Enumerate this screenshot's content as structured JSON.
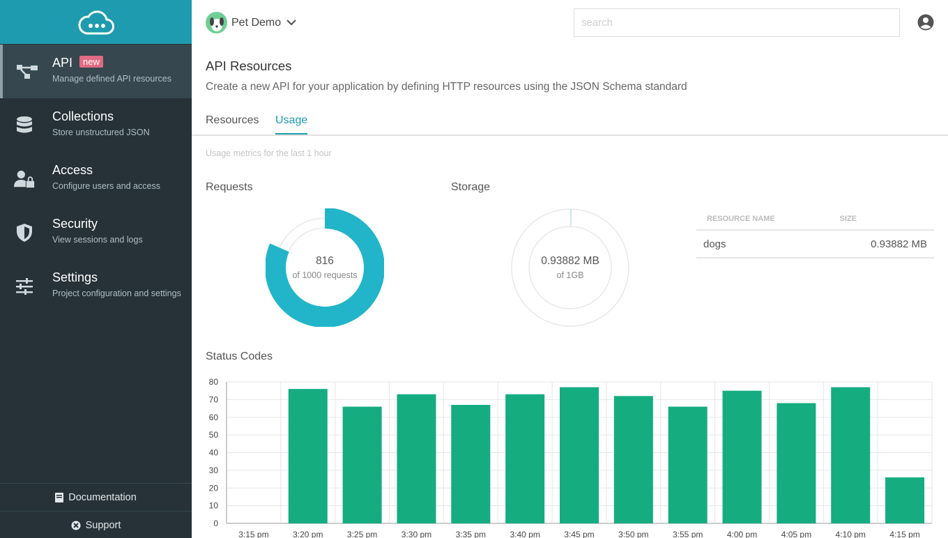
{
  "sidebar": {
    "items": [
      {
        "title": "API",
        "subtitle": "Manage defined API resources",
        "badge": "new",
        "icon": "api-icon"
      },
      {
        "title": "Collections",
        "subtitle": "Store unstructured JSON",
        "icon": "database-icon"
      },
      {
        "title": "Access",
        "subtitle": "Configure users and access",
        "icon": "user-lock-icon"
      },
      {
        "title": "Security",
        "subtitle": "View sessions and logs",
        "icon": "shield-icon"
      },
      {
        "title": "Settings",
        "subtitle": "Project configuration and settings",
        "icon": "sliders-icon"
      }
    ],
    "footer": {
      "documentation": "Documentation",
      "support": "Support"
    }
  },
  "header": {
    "project_name": "Pet Demo",
    "search_placeholder": "search"
  },
  "main": {
    "title": "API Resources",
    "description": "Create a new API for your application by defining HTTP resources using the JSON Schema standard",
    "tabs": [
      {
        "label": "Resources"
      },
      {
        "label": "Usage"
      }
    ],
    "active_tab": "Usage",
    "metrics_note": "Usage metrics for the last 1 hour",
    "requests": {
      "title": "Requests",
      "value": "816",
      "sub": "of 1000 requests",
      "used": 816,
      "total": 1000
    },
    "storage": {
      "title": "Storage",
      "value": "0.93882 MB",
      "sub": "of 1GB",
      "fraction": 0.00092
    },
    "resource_table": {
      "headers": [
        "RESOURCE NAME",
        "SIZE"
      ],
      "rows": [
        {
          "name": "dogs",
          "size": "0.93882 MB"
        }
      ]
    }
  },
  "colors": {
    "accent": "#1e9bae",
    "donut": "#22b5c9",
    "bars": "#15ac80",
    "sidebar": "#263238"
  },
  "chart_data": {
    "type": "bar",
    "title": "Status Codes",
    "categories": [
      "3:15 pm",
      "3:20 pm",
      "3:25 pm",
      "3:30 pm",
      "3:35 pm",
      "3:40 pm",
      "3:45 pm",
      "3:50 pm",
      "3:55 pm",
      "4:00 pm",
      "4:05 pm",
      "4:10 pm",
      "4:15 pm"
    ],
    "values": [
      0,
      76,
      66,
      73,
      67,
      73,
      77,
      72,
      66,
      75,
      68,
      77,
      26
    ],
    "ylim": [
      0,
      80
    ],
    "yticks": [
      0,
      10,
      20,
      30,
      40,
      50,
      60,
      70,
      80
    ],
    "grid": true
  }
}
